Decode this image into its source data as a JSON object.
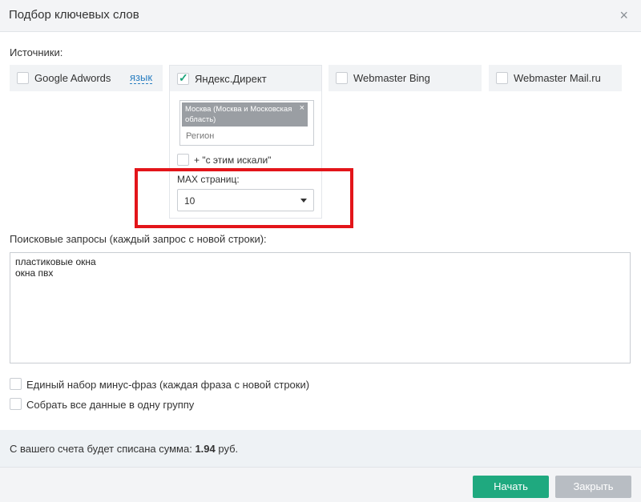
{
  "dialog": {
    "title": "Подбор ключевых слов",
    "close_icon": "×"
  },
  "sources": {
    "label": "Источники:",
    "items": [
      {
        "label": "Google Adwords",
        "checked": false,
        "link": "язык"
      },
      {
        "label": "Яндекс.Директ",
        "checked": true
      },
      {
        "label": "Webmaster Bing",
        "checked": false
      },
      {
        "label": "Webmaster Mail.ru",
        "checked": false
      }
    ]
  },
  "yandex": {
    "region_tag": "Москва (Москва и Московская область)",
    "region_tag_remove": "×",
    "region_placeholder": "Регион",
    "also_searched_label": "+ \"с этим искали\"",
    "max_pages_label": "MAX страниц:",
    "max_pages_value": "10"
  },
  "queries": {
    "label": "Поисковые запросы (каждый запрос с новой строки):",
    "value": "пластиковые окна\nокна пвх"
  },
  "options": [
    {
      "label": "Единый набор минус-фраз (каждая фраза с новой строки)",
      "checked": false
    },
    {
      "label": "Собрать все данные в одну группу",
      "checked": false
    }
  ],
  "cost": {
    "prefix": "С вашего счета будет списана сумма: ",
    "amount": "1.94",
    "suffix": " руб."
  },
  "buttons": {
    "start": "Начать",
    "close": "Закрыть"
  },
  "colors": {
    "accent": "#1fa97f",
    "highlight": "#e3151a",
    "link": "#2a7fc1"
  }
}
